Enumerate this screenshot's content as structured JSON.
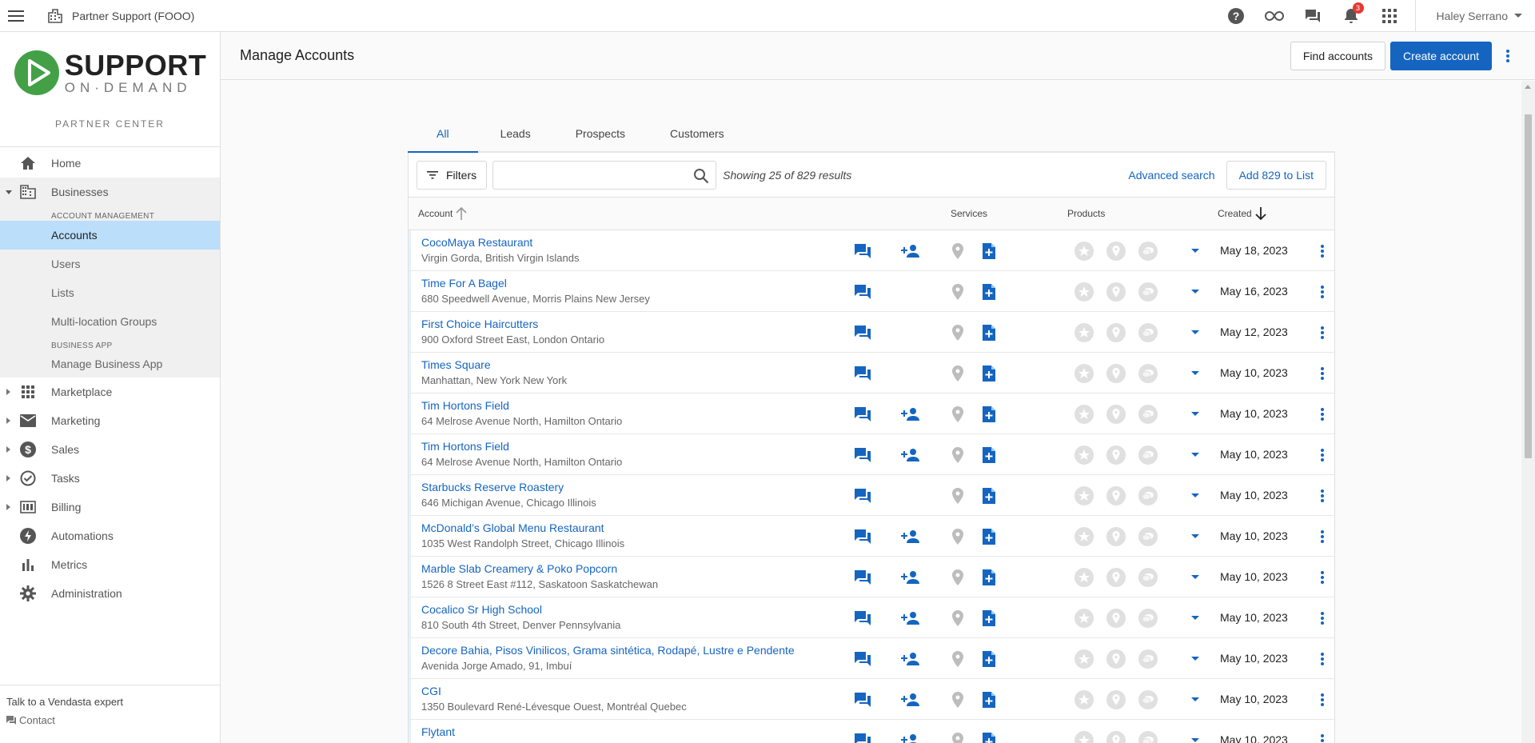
{
  "topbar": {
    "org_name": "Partner Support (FOOO)",
    "notification_count": "3",
    "user_name": "Haley Serrano"
  },
  "brand": {
    "logo_word1": "SUPPORT",
    "logo_word2": "ON·DEMAND",
    "subtitle": "PARTNER CENTER",
    "logo_color": "#43a047"
  },
  "sidebar": {
    "home": "Home",
    "businesses": "Businesses",
    "account_management_heading": "ACCOUNT MANAGEMENT",
    "accounts": "Accounts",
    "users": "Users",
    "lists": "Lists",
    "multi_location": "Multi-location Groups",
    "business_app_heading": "BUSINESS APP",
    "manage_business_app": "Manage Business App",
    "marketplace": "Marketplace",
    "marketing": "Marketing",
    "sales": "Sales",
    "tasks": "Tasks",
    "billing": "Billing",
    "automations": "Automations",
    "metrics": "Metrics",
    "administration": "Administration",
    "footer_talk": "Talk to a Vendasta expert",
    "footer_contact": "Contact"
  },
  "header": {
    "title": "Manage Accounts",
    "find_accounts": "Find accounts",
    "create_account": "Create account"
  },
  "tabs": [
    "All",
    "Leads",
    "Prospects",
    "Customers"
  ],
  "toolbar": {
    "filters": "Filters",
    "search_placeholder": "",
    "results_text": "Showing 25 of 829 results",
    "advanced_search": "Advanced search",
    "add_to_list": "Add 829 to List"
  },
  "table": {
    "col_account": "Account",
    "col_services": "Services",
    "col_products": "Products",
    "col_created": "Created",
    "rows": [
      {
        "name": "CocoMaya Restaurant",
        "address": "Virgin Gorda, British Virgin Islands",
        "date": "May 18, 2023",
        "has_user": true
      },
      {
        "name": "Time For A Bagel",
        "address": "680 Speedwell Avenue, Morris Plains New Jersey",
        "date": "May 16, 2023",
        "has_user": false
      },
      {
        "name": "First Choice Haircutters",
        "address": "900 Oxford Street East, London Ontario",
        "date": "May 12, 2023",
        "has_user": false
      },
      {
        "name": "Times Square",
        "address": "Manhattan, New York New York",
        "date": "May 10, 2023",
        "has_user": false
      },
      {
        "name": "Tim Hortons Field",
        "address": "64 Melrose Avenue North, Hamilton Ontario",
        "date": "May 10, 2023",
        "has_user": true
      },
      {
        "name": "Tim Hortons Field",
        "address": "64 Melrose Avenue North, Hamilton Ontario",
        "date": "May 10, 2023",
        "has_user": true
      },
      {
        "name": "Starbucks Reserve Roastery",
        "address": "646 Michigan Avenue, Chicago Illinois",
        "date": "May 10, 2023",
        "has_user": false
      },
      {
        "name": "McDonald’s Global Menu Restaurant",
        "address": "1035 West Randolph Street, Chicago Illinois",
        "date": "May 10, 2023",
        "has_user": true
      },
      {
        "name": "Marble Slab Creamery & Poko Popcorn",
        "address": "1526 8 Street East #112, Saskatoon Saskatchewan",
        "date": "May 10, 2023",
        "has_user": true
      },
      {
        "name": "Cocalico Sr High School",
        "address": "810 South 4th Street, Denver Pennsylvania",
        "date": "May 10, 2023",
        "has_user": true
      },
      {
        "name": "Decore Bahia, Pisos Vinilicos, Grama sintética, Rodapé, Lustre e Pendente",
        "address": "Avenida Jorge Amado, 91, Imbuí",
        "date": "May 10, 2023",
        "has_user": true
      },
      {
        "name": "CGI",
        "address": "1350 Boulevard René-Lévesque Ouest, Montréal Quebec",
        "date": "May 10, 2023",
        "has_user": true
      },
      {
        "name": "Flytant",
        "address": "",
        "date": "May 10, 2023",
        "has_user": true
      }
    ]
  },
  "colors": {
    "primary": "#1565c0",
    "active_nav": "#bbdefb",
    "icon_gray": "#bdbdbd"
  }
}
